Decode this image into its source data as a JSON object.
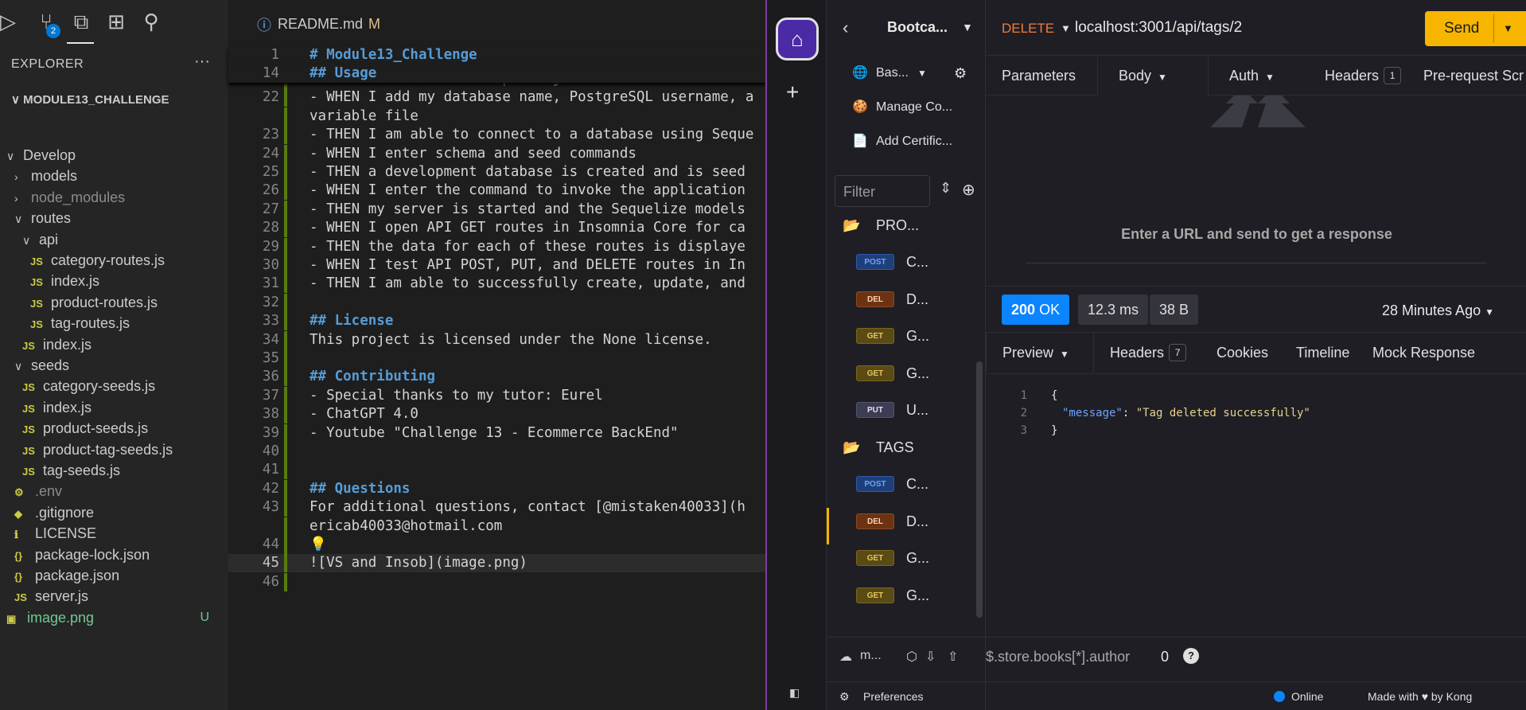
{
  "vscode": {
    "activity_badge": "2",
    "explorer_title": "EXPLORER",
    "explorer_more": "···",
    "project": "MODULE13_CHALLENGE",
    "tree": [
      {
        "label": "Develop",
        "indent": 1,
        "chev": "∨"
      },
      {
        "label": "models",
        "indent": 2,
        "chev": "›"
      },
      {
        "label": "node_modules",
        "indent": 2,
        "chev": "›",
        "dim": true
      },
      {
        "label": "routes",
        "indent": 2,
        "chev": "∨"
      },
      {
        "label": "api",
        "indent": 3,
        "chev": "∨"
      },
      {
        "label": "category-routes.js",
        "indent": 4,
        "icon": "JS"
      },
      {
        "label": "index.js",
        "indent": 4,
        "icon": "JS"
      },
      {
        "label": "product-routes.js",
        "indent": 4,
        "icon": "JS"
      },
      {
        "label": "tag-routes.js",
        "indent": 4,
        "icon": "JS"
      },
      {
        "label": "index.js",
        "indent": 3,
        "icon": "JS"
      },
      {
        "label": "seeds",
        "indent": 2,
        "chev": "∨"
      },
      {
        "label": "category-seeds.js",
        "indent": 3,
        "icon": "JS"
      },
      {
        "label": "index.js",
        "indent": 3,
        "icon": "JS"
      },
      {
        "label": "product-seeds.js",
        "indent": 3,
        "icon": "JS"
      },
      {
        "label": "product-tag-seeds.js",
        "indent": 3,
        "icon": "JS"
      },
      {
        "label": "tag-seeds.js",
        "indent": 3,
        "icon": "JS"
      },
      {
        "label": ".env",
        "indent": 2,
        "icon": "⚙",
        "dim": true
      },
      {
        "label": ".gitignore",
        "indent": 2,
        "icon": "◆"
      },
      {
        "label": "LICENSE",
        "indent": 2,
        "icon": "ℹ"
      },
      {
        "label": "package-lock.json",
        "indent": 2,
        "icon": "{}"
      },
      {
        "label": "package.json",
        "indent": 2,
        "icon": "{}"
      },
      {
        "label": "server.js",
        "indent": 2,
        "icon": "JS"
      },
      {
        "label": "image.png",
        "indent": 1,
        "icon": "▣",
        "git": true,
        "flag": "U"
      }
    ],
    "tab_label": "README.md",
    "tab_mod": "M",
    "sticky_lines": [
      {
        "num": "1",
        "text": "# Module13_Challenge"
      },
      {
        "num": "14",
        "text": "## Usage"
      }
    ],
    "lines": [
      {
        "num": "",
        "text": "- GIVEN a functional Express.js API"
      },
      {
        "num": "22",
        "text": "- WHEN I add my database name, PostgreSQL username, a"
      },
      {
        "num": "",
        "text": "variable file"
      },
      {
        "num": "23",
        "text": "- THEN I am able to connect to a database using Seque"
      },
      {
        "num": "24",
        "text": "- WHEN I enter schema and seed commands"
      },
      {
        "num": "25",
        "text": "- THEN a development database is created and is seed"
      },
      {
        "num": "26",
        "text": "- WHEN I enter the command to invoke the application"
      },
      {
        "num": "27",
        "text": "- THEN my server is started and the Sequelize models"
      },
      {
        "num": "28",
        "text": "- WHEN I open API GET routes in Insomnia Core for ca"
      },
      {
        "num": "29",
        "text": "- THEN the data for each of these routes is displaye"
      },
      {
        "num": "30",
        "text": "- WHEN I test API POST, PUT, and DELETE routes in In"
      },
      {
        "num": "31",
        "text": "- THEN I am able to successfully create, update, and"
      },
      {
        "num": "32",
        "text": ""
      },
      {
        "num": "33",
        "text": "## License",
        "hd": true
      },
      {
        "num": "34",
        "text": "This project is licensed under the None license."
      },
      {
        "num": "35",
        "text": ""
      },
      {
        "num": "36",
        "text": "## Contributing",
        "hd": true
      },
      {
        "num": "37",
        "text": "- Special thanks to my tutor: Eurel"
      },
      {
        "num": "38",
        "text": "- ChatGPT 4.0"
      },
      {
        "num": "39",
        "text": "- Youtube \"Challenge 13 - Ecommerce BackEnd\""
      },
      {
        "num": "40",
        "text": ""
      },
      {
        "num": "41",
        "text": ""
      },
      {
        "num": "42",
        "text": "## Questions",
        "hd": true
      },
      {
        "num": "43",
        "text": "For additional questions, contact [@mistaken40033](h"
      },
      {
        "num": "",
        "text": "ericab40033@hotmail.com"
      },
      {
        "num": "44",
        "text": "💡"
      },
      {
        "num": "45",
        "text": "![VS and Insob](image.png)",
        "active": true
      },
      {
        "num": "46",
        "text": ""
      }
    ]
  },
  "insomnia": {
    "project_name": "Bootca...",
    "sidebar_top": [
      {
        "icon": "🌐",
        "label": "Bas..."
      },
      {
        "icon": "🍪",
        "label": "Manage Co..."
      },
      {
        "icon": "📄",
        "label": "Add Certific..."
      }
    ],
    "filter_placeholder": "Filter",
    "folders": [
      {
        "name": "PRO...",
        "requests": [
          {
            "method": "POST",
            "label": "C..."
          },
          {
            "method": "DEL",
            "label": "D..."
          },
          {
            "method": "GET",
            "label": "G..."
          },
          {
            "method": "GET",
            "label": "G..."
          },
          {
            "method": "PUT",
            "label": "U..."
          }
        ]
      },
      {
        "name": "TAGS",
        "requests": [
          {
            "method": "POST",
            "label": "C..."
          },
          {
            "method": "DEL",
            "label": "D..."
          },
          {
            "method": "GET",
            "label": "G..."
          },
          {
            "method": "GET",
            "label": "G..."
          }
        ]
      }
    ],
    "sidebar_bottom_label": "m...",
    "preferences": "Preferences",
    "method": "DELETE",
    "url": "localhost:3001/api/tags/2",
    "send": "Send",
    "request_tabs": [
      {
        "label": "Parameters"
      },
      {
        "label": "Body",
        "caret": true
      },
      {
        "label": "Auth",
        "caret": true
      },
      {
        "label": "Headers",
        "count": "1"
      },
      {
        "label": "Pre-request Scr"
      }
    ],
    "empty_message": "Enter a URL and send to get a response",
    "status_code": "200",
    "status_text": "OK",
    "time": "12.3 ms",
    "size": "38 B",
    "ago": "28 Minutes Ago",
    "response_tabs": [
      {
        "label": "Preview",
        "caret": true
      },
      {
        "label": "Headers",
        "count": "7"
      },
      {
        "label": "Cookies"
      },
      {
        "label": "Timeline"
      },
      {
        "label": "Mock Response"
      }
    ],
    "response_lines": [
      {
        "num": "1",
        "text": "{"
      },
      {
        "num": "2",
        "key": "\"message\"",
        "val": "\"Tag deleted successfully\""
      },
      {
        "num": "3",
        "text": "}"
      }
    ],
    "filter_query": "$.store.books[*].author",
    "filter_count": "0",
    "online": "Online",
    "made_with": "Made with ♥ by Kong",
    "colors": {
      "send": "#f7b500",
      "status_ok": "#0a84ff",
      "method_delete": "#f07c3c"
    }
  }
}
